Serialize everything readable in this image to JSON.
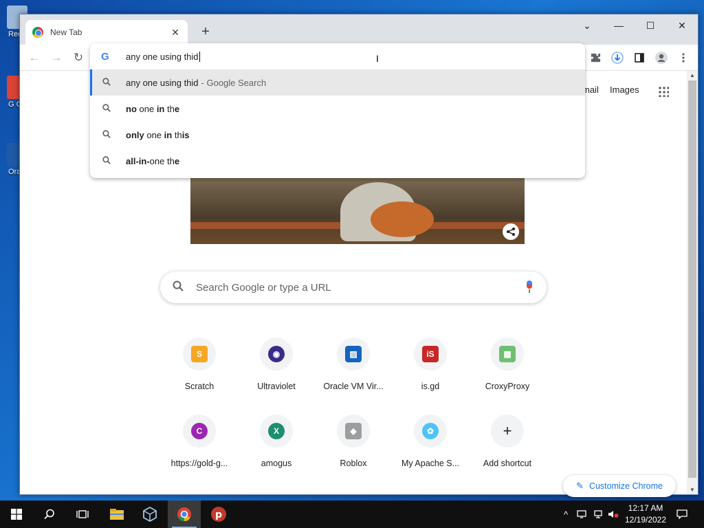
{
  "desktop": {
    "icons": [
      {
        "label": "Rec",
        "color": "#9bb8d8"
      },
      {
        "label": "G Ch",
        "color": "#db4437"
      },
      {
        "label": "Ora Virt",
        "color": "#1f5aa6"
      }
    ]
  },
  "browser": {
    "tab": {
      "title": "New Tab",
      "close_glyph": "✕"
    },
    "new_tab_glyph": "+",
    "window_controls": {
      "tab_search": "⌄",
      "minimize": "—",
      "maximize": "☐",
      "close": "✕"
    },
    "nav": {
      "back": "←",
      "forward": "→",
      "reload": "↻"
    },
    "toolbar_icons": [
      "puzzle-icon",
      "download-icon",
      "side-panel-icon",
      "profile-icon",
      "more-menu-icon"
    ],
    "omnibox": {
      "value": "any one using thid",
      "suggestions": [
        {
          "parts": [
            {
              "t": "any one using thid",
              "b": false
            }
          ],
          "suffix": "- Google Search",
          "selected": true
        },
        {
          "parts": [
            {
              "t": "no",
              "b": true
            },
            {
              "t": " one ",
              "b": false
            },
            {
              "t": "in",
              "b": true
            },
            {
              "t": " th",
              "b": false
            },
            {
              "t": "e",
              "b": true
            }
          ],
          "suffix": "",
          "selected": false
        },
        {
          "parts": [
            {
              "t": "only",
              "b": true
            },
            {
              "t": " one ",
              "b": false
            },
            {
              "t": "in",
              "b": true
            },
            {
              "t": " th",
              "b": false
            },
            {
              "t": "is",
              "b": true
            }
          ],
          "suffix": "",
          "selected": false
        },
        {
          "parts": [
            {
              "t": "all-in-",
              "b": true
            },
            {
              "t": "one th",
              "b": false
            },
            {
              "t": "e",
              "b": true
            }
          ],
          "suffix": "",
          "selected": false
        }
      ]
    }
  },
  "page": {
    "gmail_partial": "mail",
    "images_link": "Images",
    "search_placeholder": "Search Google or type a URL",
    "shortcuts": [
      {
        "label": "Scratch",
        "glyph": "S",
        "color": "#f5a623",
        "round": false
      },
      {
        "label": "Ultraviolet",
        "glyph": "◉",
        "color": "#3b2a8c",
        "round": true
      },
      {
        "label": "Oracle VM Vir...",
        "glyph": "▨",
        "color": "#1565c0",
        "round": false
      },
      {
        "label": "is.gd",
        "glyph": "iS",
        "color": "#c62828",
        "round": false
      },
      {
        "label": "CroxyProxy",
        "glyph": "▦",
        "color": "#6fbf73",
        "round": false
      },
      {
        "label": "https://gold-g...",
        "glyph": "C",
        "color": "#9c27b0",
        "round": true
      },
      {
        "label": "amogus",
        "glyph": "X",
        "color": "#1e8e6e",
        "round": true
      },
      {
        "label": "Roblox",
        "glyph": "◆",
        "color": "#9e9e9e",
        "round": false
      },
      {
        "label": "My Apache S...",
        "glyph": "✿",
        "color": "#4fc3f7",
        "round": true
      },
      {
        "label": "Add shortcut",
        "glyph": "+",
        "color": "#f1f3f4",
        "round": true
      }
    ],
    "customize_label": "Customize Chrome",
    "share_glyph": "⋖"
  },
  "taskbar": {
    "clock_time": "12:17 AM",
    "clock_date": "12/19/2022"
  },
  "colors": {
    "accent": "#1a73e8",
    "selected_row_bg": "#e8e8e9",
    "taskbar_bg": "#101010"
  }
}
